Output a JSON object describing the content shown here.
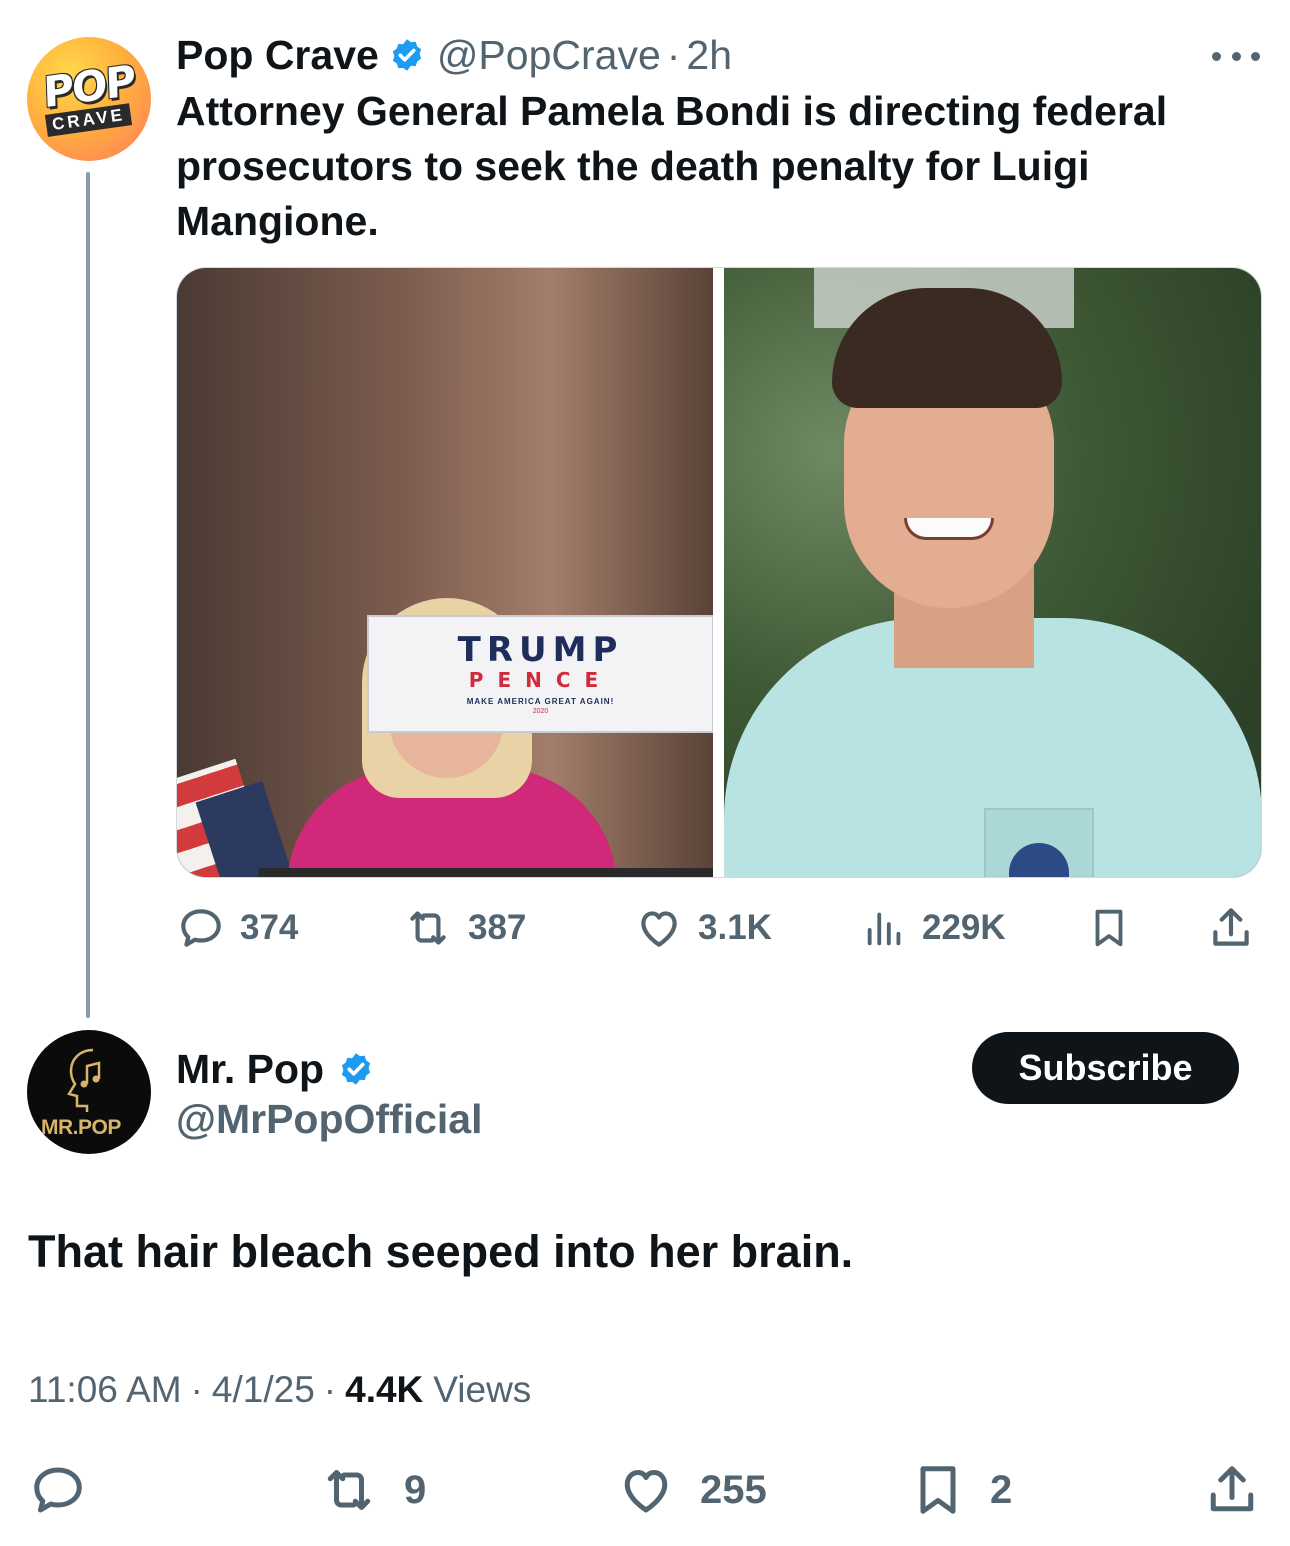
{
  "quoted_tweet": {
    "avatar": {
      "line1": "POP",
      "line2": "CRAVE"
    },
    "display_name": "Pop Crave",
    "handle": "@PopCrave",
    "separator": "·",
    "time": "2h",
    "text": "Attorney General Pamela Bondi is directing federal prosecutors to seek the death penalty for Luigi Mangione.",
    "media_sign": {
      "line1": "TRUMP",
      "line2": "PENCE",
      "line3": "MAKE AMERICA GREAT AGAIN!",
      "line4": "2020"
    },
    "actions": {
      "replies": "374",
      "reposts": "387",
      "likes": "3.1K",
      "views": "229K"
    }
  },
  "reply_tweet": {
    "avatar_label": "MR.POP",
    "display_name": "Mr. Pop",
    "handle": "@MrPopOfficial",
    "subscribe_label": "Subscribe",
    "text": "That hair bleach seeped into her brain.",
    "time": "11:06 AM",
    "date": "4/1/25",
    "separator": "·",
    "views_count": "4.4K",
    "views_label": "Views",
    "actions": {
      "reposts": "9",
      "likes": "255",
      "bookmarks": "2"
    }
  },
  "colors": {
    "text": "#0f1419",
    "secondary": "#536471",
    "verified": "#1d9bf0",
    "thread_line": "#8b98a5"
  },
  "icons": [
    "verified-badge-icon",
    "more-icon",
    "reply-icon",
    "repost-icon",
    "like-icon",
    "views-icon",
    "bookmark-icon",
    "share-icon"
  ]
}
